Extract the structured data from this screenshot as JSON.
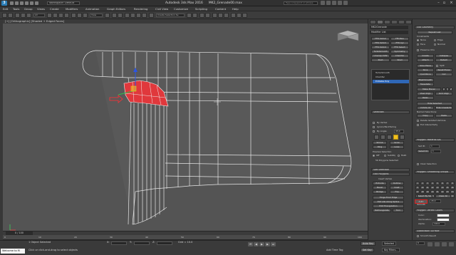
{
  "window": {
    "app_title": "Autodesk 3ds Max 2016",
    "file_name": "MK2_Grenade00.max",
    "workspace": "Workspace: Default",
    "search_placeholder": "Type a keyword or phrase"
  },
  "menu": {
    "items": [
      "Edit",
      "Tools",
      "Group",
      "Views",
      "Create",
      "Modifiers",
      "Animation",
      "Graph Editors",
      "Rendering",
      "Civil View",
      "Customize",
      "Scripting",
      "Content",
      "Help"
    ]
  },
  "toolbar": {
    "selection_filter": "All",
    "view_dropdown": "View",
    "named_selection": "Create Selection Se"
  },
  "viewport": {
    "label": "[+] [Orthographic] [Shaded + Edged Faces]"
  },
  "timeline": {
    "frame_counter": "0 / 100",
    "ticks": [
      "0",
      "10",
      "20",
      "30",
      "40",
      "50",
      "60",
      "70",
      "80",
      "90",
      "100"
    ]
  },
  "status": {
    "maxscript": "Welcome to M",
    "selection_info": "1 Object Selected",
    "prompt": "Click or click-and-drag to select objects",
    "x_label": "X:",
    "y_label": "Y:",
    "z_label": "Z:",
    "grid": "Grid = 10.0",
    "add_time_tag": "Add Time Tag",
    "auto_key": "Auto Key",
    "set_key": "Set Key",
    "key_filters": "Key Filters...",
    "selected_dropdown": "Selected",
    "frame_value": "0"
  },
  "scene_panel": {
    "object_name": "MK2Grenade",
    "modifier_list": "Modifier List",
    "buttons": [
      [
        "FFD 2x2x2",
        "FFD Box"
      ],
      [
        "FFD 3x3x3",
        "FFD Cyl"
      ],
      [
        "FFD 4x4x4",
        "FFD Select"
      ],
      [
        "TurboSmooth",
        "Symmetry"
      ],
      [
        "Unwrap UVW",
        "Chamfer"
      ],
      [
        "Push",
        "Shell"
      ]
    ],
    "stack": [
      "TurboSmooth",
      "Chamfer",
      "Editable Poly"
    ],
    "selection_title": "Selection",
    "by_vertex": "By Vertex",
    "ignore_backfacing": "Ignore Backfacing",
    "by_angle": "By Angle:",
    "by_angle_value": "45.0",
    "shrink": "Shrink",
    "grow": "Grow",
    "ring": "Ring",
    "loop": "Loop",
    "preview_selection": "Preview Selection",
    "preview_options": [
      "Off",
      "SubObj",
      "Multi"
    ],
    "selected_count": "59 Polygons Selected",
    "soft_selection_title": "Soft Selection",
    "edit_polygons_title": "Edit Polygons",
    "insert_vertex": "Insert Vertex",
    "buttons_edit": [
      [
        "Extrude",
        "Outline"
      ],
      [
        "Bevel",
        "Inset"
      ],
      [
        "Bridge",
        "Flip"
      ]
    ],
    "hinge_from_edge": "Hinge From Edge",
    "extrude_along_spline": "Extrude Along Spline",
    "edit_triangulation": "Edit Triangulation",
    "retriangulate": "Retriangulate",
    "turn": "Turn"
  },
  "command_panel": {
    "edit_geometry_title": "Edit Geometry",
    "repeat_last": "Repeat Last",
    "constraints_label": "Constraints",
    "constraints": [
      "None",
      "Edge",
      "Face",
      "Normal"
    ],
    "preserve_uvs": "Preserve UVs",
    "create": "Create",
    "collapse": "Collapse",
    "attach": "Attach",
    "detach": "Detach",
    "slice_plane": "Slice Plane",
    "split": "Split",
    "slice": "Slice",
    "reset_plane": "Reset Plane",
    "quickslice": "QuickSlice",
    "cut": "Cut",
    "meshsmooth": "MeshSmooth",
    "tessellate": "Tessellate",
    "make_planar": "Make Planar",
    "xyz": [
      "X",
      "Y",
      "Z"
    ],
    "view_align": "View Align",
    "grid_align": "Grid Align",
    "relax": "Relax",
    "hide_selected": "Hide Selected",
    "unhide_all": "Unhide All",
    "hide_unselected": "Hide Unselected",
    "named_selections": "Named Selections:",
    "copy": "Copy",
    "paste": "Paste",
    "delete_isolated": "Delete Isolated Vertices",
    "full_interactivity": "Full Interactivity",
    "material_ids_title": "Polygon: Material IDs",
    "set_id": "Set ID:",
    "select_id": "Select ID",
    "id_value": "1",
    "clear_selection": "Clear Selection",
    "smoothing_groups_title": "Polygon: Smoothing Groups",
    "sg_numbers": [
      "1",
      "2",
      "3",
      "4",
      "5",
      "6",
      "7",
      "8",
      "9",
      "10",
      "11",
      "12",
      "13",
      "14",
      "15",
      "16",
      "17",
      "18",
      "19",
      "20",
      "21",
      "22",
      "23",
      "24",
      "25",
      "26",
      "27",
      "28",
      "29",
      "30",
      "31",
      "32"
    ],
    "select_by_sg": "Select By SG",
    "clear_all": "Clear All",
    "auto_smooth": "Auto Smooth",
    "auto_smooth_value": "45.0",
    "vertex_colors_title": "Polygon: Vertex Colors",
    "color": "Color:",
    "illumination": "Illumination:",
    "alpha": "Alpha:",
    "alpha_value": "100.0",
    "subdivision_title": "Subdivision Surface",
    "smooth_result": "Smooth Result"
  },
  "colors": {
    "selection_red": "#e0383c",
    "accent_yellow": "#f2c01e",
    "selected_blue": "#2f67b6"
  }
}
